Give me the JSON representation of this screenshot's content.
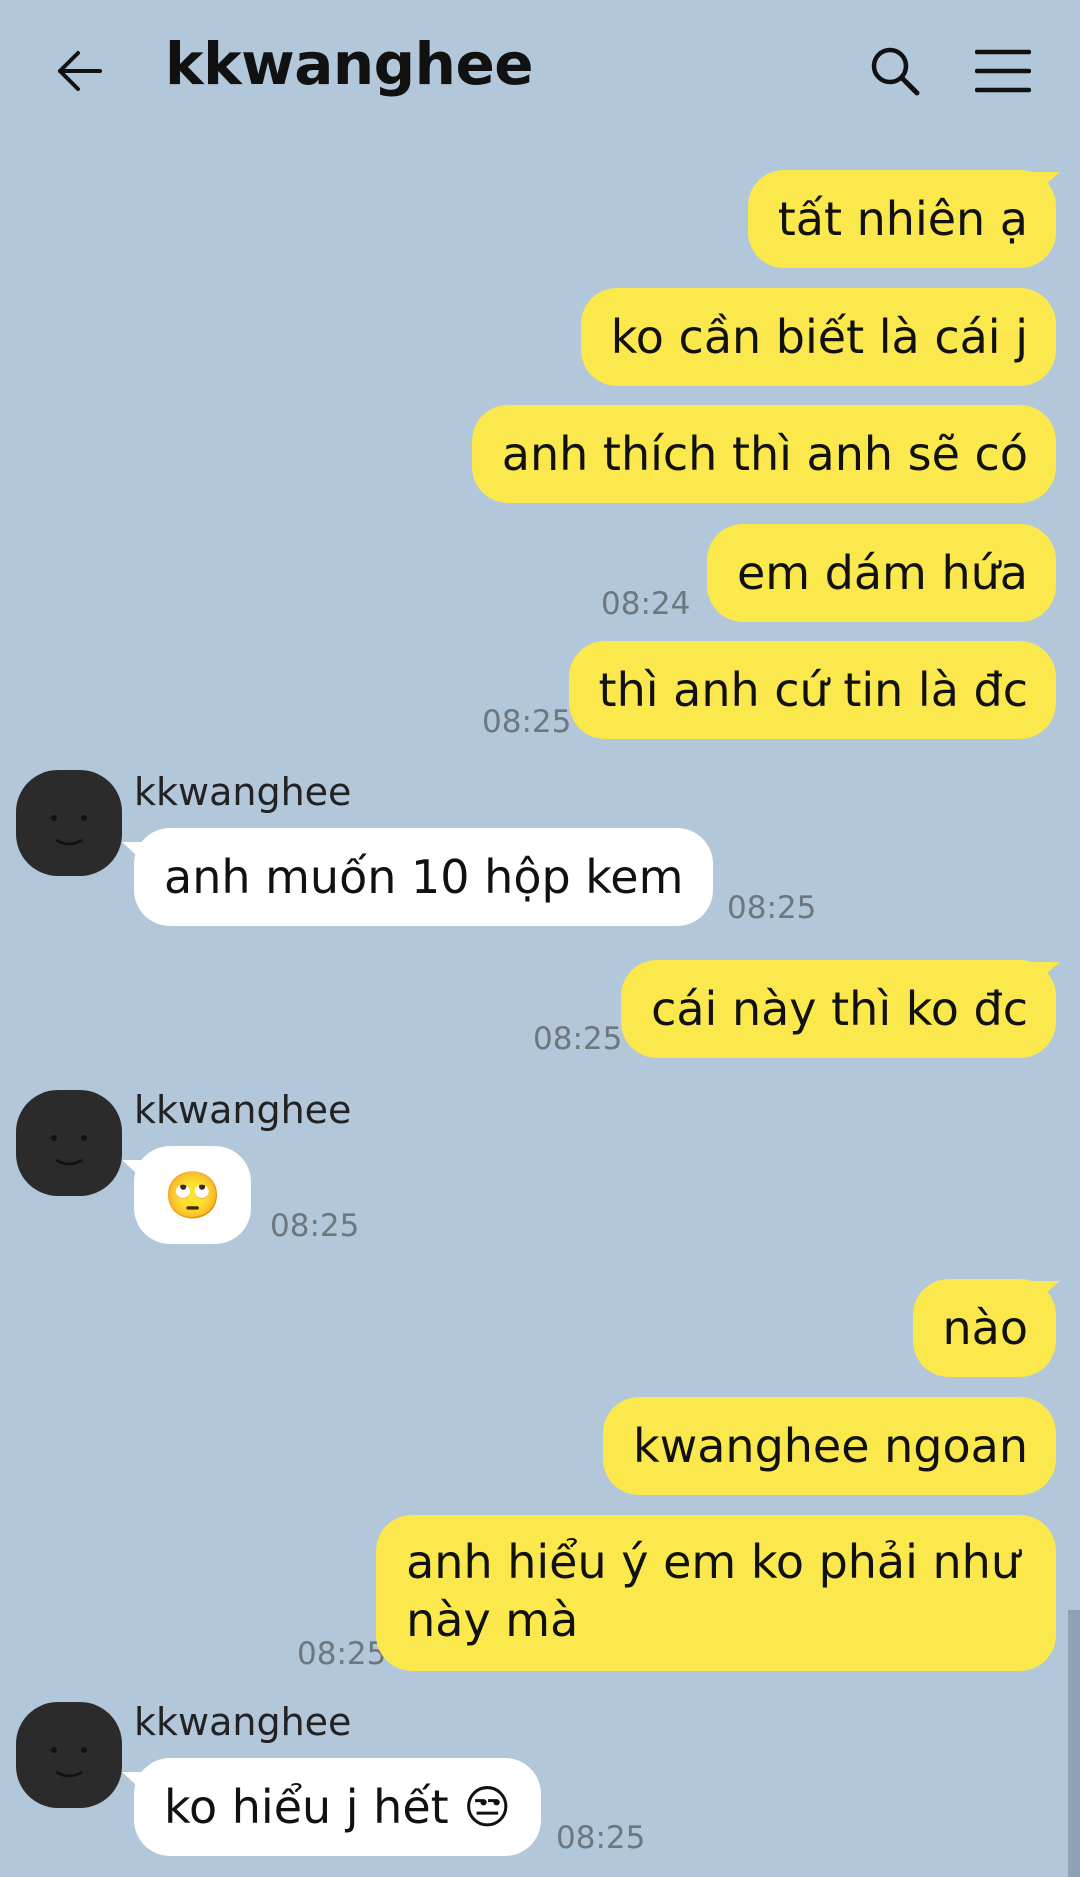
{
  "header": {
    "title": "kkwanghee",
    "back_icon": "arrow-left-icon",
    "search_icon": "search-icon",
    "menu_icon": "hamburger-menu-icon"
  },
  "colors": {
    "background": "#b2c7da",
    "outgoing_bubble": "#fae84c",
    "incoming_bubble": "#ffffff"
  },
  "messages": [
    {
      "direction": "out",
      "text": "tất nhiên ạ",
      "time": ""
    },
    {
      "direction": "out",
      "text": "ko cần biết là cái j",
      "time": ""
    },
    {
      "direction": "out",
      "text": "anh thích thì anh sẽ có",
      "time": ""
    },
    {
      "direction": "out",
      "text": "em dám hứa",
      "time": "08:24"
    },
    {
      "direction": "out",
      "text": "thì anh cứ tin là đc",
      "time": "08:25"
    },
    {
      "direction": "in",
      "sender": "kkwanghee",
      "text": "anh muốn 10 hộp kem",
      "time": "08:25"
    },
    {
      "direction": "out",
      "text": "cái này thì ko đc",
      "time": "08:25"
    },
    {
      "direction": "in",
      "sender": "kkwanghee",
      "text": "🙄",
      "time": "08:25"
    },
    {
      "direction": "out",
      "text": "nào",
      "time": ""
    },
    {
      "direction": "out",
      "text": "kwanghee ngoan",
      "time": ""
    },
    {
      "direction": "out",
      "text_line1": "anh hiểu ý em ko phải như",
      "text_line2": "này mà",
      "time": "08:25"
    },
    {
      "direction": "in",
      "sender": "kkwanghee",
      "text": "ko hiểu j hết 😒",
      "time": "08:25"
    }
  ]
}
